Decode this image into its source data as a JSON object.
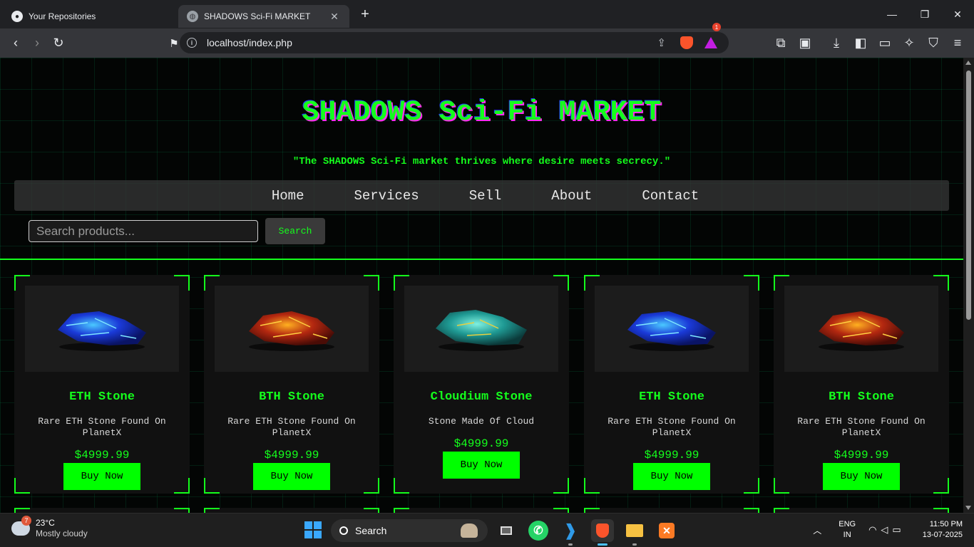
{
  "browser": {
    "tabs": [
      {
        "title": "Your Repositories",
        "icon": "github-icon",
        "active": false
      },
      {
        "title": "SHADOWS Sci-Fi MARKET",
        "icon": "globe-icon",
        "active": true
      }
    ],
    "url": "localhost/index.php",
    "rewards_badge": "1"
  },
  "page": {
    "title": "SHADOWS Sci-Fi MARKET",
    "tagline": "\"The SHADOWS Sci-Fi market thrives where desire meets secrecy.\"",
    "nav": [
      "Home",
      "Services",
      "Sell",
      "About",
      "Contact"
    ],
    "search": {
      "placeholder": "Search products...",
      "button": "Search"
    },
    "products": [
      {
        "name": "ETH Stone",
        "desc": "Rare ETH Stone Found On PlanetX",
        "price": "$4999.99",
        "button": "Buy Now",
        "stone": "blue"
      },
      {
        "name": "BTH Stone",
        "desc": "Rare ETH Stone Found On PlanetX",
        "price": "$4999.99",
        "button": "Buy Now",
        "stone": "red"
      },
      {
        "name": "Cloudium Stone",
        "desc": "Stone Made Of Cloud",
        "price": "$4999.99",
        "button": "Buy Now",
        "stone": "teal"
      },
      {
        "name": "ETH Stone",
        "desc": "Rare ETH Stone Found On PlanetX",
        "price": "$4999.99",
        "button": "Buy Now",
        "stone": "blue"
      },
      {
        "name": "BTH Stone",
        "desc": "Rare ETH Stone Found On PlanetX",
        "price": "$4999.99",
        "button": "Buy Now",
        "stone": "red"
      }
    ],
    "accent": "#14ff1c"
  },
  "taskbar": {
    "weather": {
      "temp": "23°C",
      "condition": "Mostly cloudy",
      "badge": "7"
    },
    "search": "Search",
    "lang": [
      "ENG",
      "IN"
    ],
    "time": "11:50 PM",
    "date": "13-07-2025"
  }
}
